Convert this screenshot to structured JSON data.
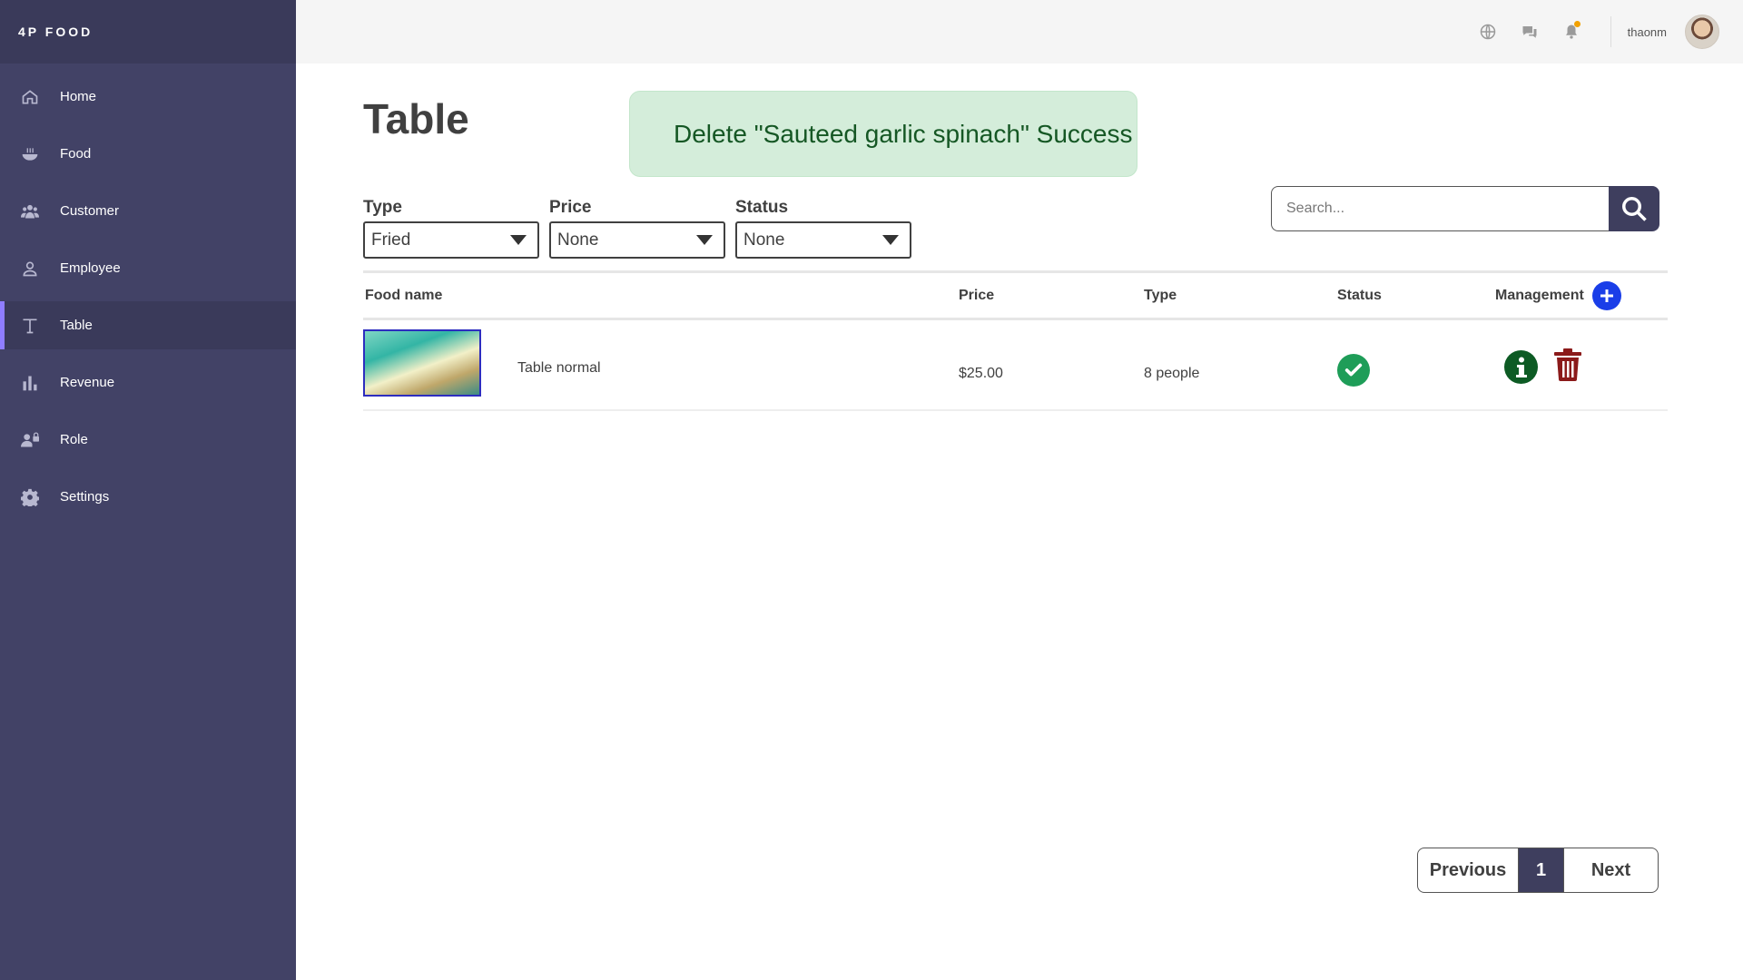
{
  "brand": "4P FOOD",
  "sidebar": {
    "items": [
      {
        "label": "Home",
        "icon": "home-icon"
      },
      {
        "label": "Food",
        "icon": "bowl-icon"
      },
      {
        "label": "Customer",
        "icon": "users-icon"
      },
      {
        "label": "Employee",
        "icon": "user-icon"
      },
      {
        "label": "Table",
        "icon": "text-t-icon",
        "active": true
      },
      {
        "label": "Revenue",
        "icon": "bar-chart-icon"
      },
      {
        "label": "Role",
        "icon": "user-lock-icon"
      },
      {
        "label": "Settings",
        "icon": "gear-icon"
      }
    ]
  },
  "topbar": {
    "icons": [
      "globe-icon",
      "chat-icon",
      "bell-icon"
    ],
    "notification_dot_color": "#f2a100",
    "username": "thaonm"
  },
  "page": {
    "title": "Table",
    "toast": "Delete \"Sauteed garlic spinach\" Success"
  },
  "filters": {
    "type": {
      "label": "Type",
      "value": "Fried"
    },
    "price": {
      "label": "Price",
      "value": "None"
    },
    "status": {
      "label": "Status",
      "value": "None"
    }
  },
  "search": {
    "placeholder": "Search..."
  },
  "table": {
    "headers": {
      "name": "Food name",
      "price": "Price",
      "type": "Type",
      "status": "Status",
      "management": "Management"
    },
    "rows": [
      {
        "name": "Table normal",
        "price": "$25.00",
        "type": "8 people",
        "status": "check-circle-icon"
      }
    ]
  },
  "pagination": {
    "previous": "Previous",
    "current": "1",
    "next": "Next"
  },
  "colors": {
    "sidebar": "#424266",
    "sidebar_dark": "#3a3a5a",
    "active_accent": "#8f7dff",
    "toast_bg": "#d4edda",
    "toast_text": "#155724",
    "add_button": "#1a3ee8",
    "status_ok": "#1e9d58",
    "info": "#0d5b24",
    "delete": "#8b1a1a"
  }
}
